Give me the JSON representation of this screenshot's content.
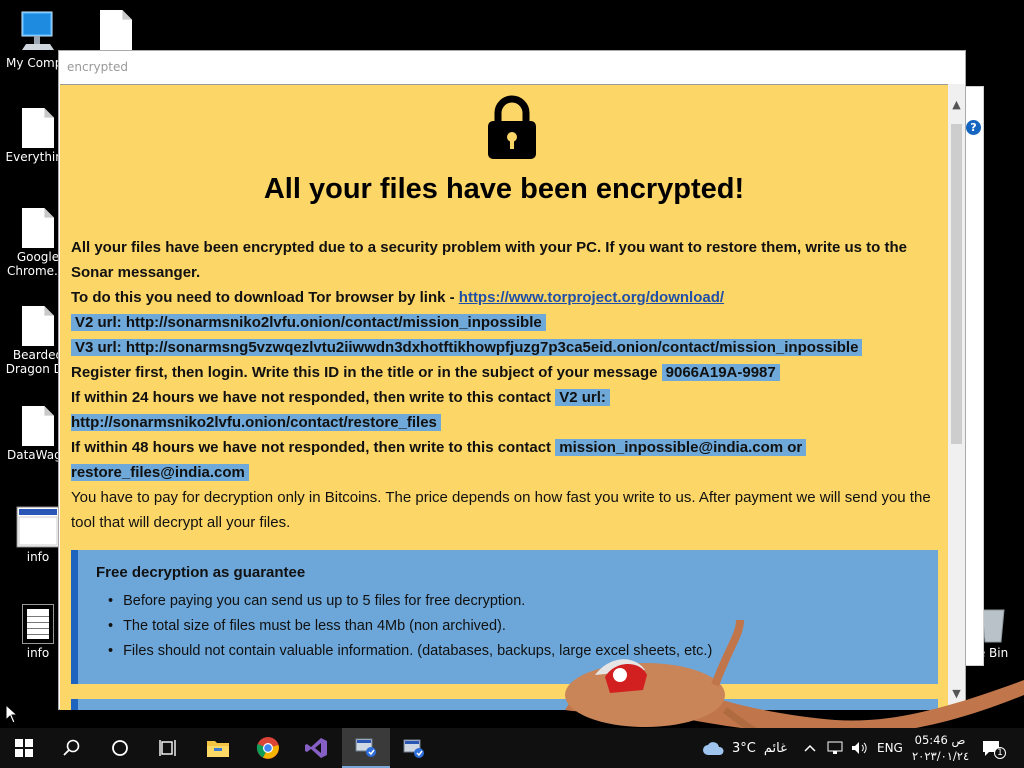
{
  "desktop": {
    "icons": [
      {
        "label": "My Compu",
        "icon": "computer-icon"
      },
      {
        "label": "",
        "icon": "file-icon"
      },
      {
        "label": "Everything",
        "icon": "file-icon"
      },
      {
        "label": "Google\nChrome.In",
        "icon": "file-icon"
      },
      {
        "label": "Bearded\nDragon De",
        "icon": "file-icon"
      },
      {
        "label": "DataWago",
        "icon": "file-icon"
      },
      {
        "label": "info",
        "icon": "window-icon"
      },
      {
        "label": "info",
        "icon": "text-file-icon"
      },
      {
        "label": "e Bin",
        "icon": "recycle-bin-icon"
      }
    ]
  },
  "window": {
    "title": "encrypted"
  },
  "note": {
    "heading": "All your files have been encrypted!",
    "para1": "All your files have been encrypted due to a security problem with your PC. If you want to restore them, write us to the Sonar messanger.",
    "tor_prefix": "To do this you need to download Tor browser by link - ",
    "tor_link": "https://www.torproject.org/download/",
    "v2_url": "V2 url: http://sonarmsniko2lvfu.onion/contact/mission_inpossible",
    "v3_url": "V3 url: http://sonarmsng5vzwqezlvtu2iiwwdn3dxhotftikhowpfjuzg7p3ca5eid.onion/contact/mission_inpossible",
    "register_prefix": "Register first, then login. Write this ID in the title or in the subject of your message",
    "id": "9066A19A-9987",
    "within24_prefix": "If within 24 hours we have not responded, then write to this contact",
    "within24_contact_a": "V2 url:",
    "within24_contact_b": "http://sonarmsniko2lvfu.onion/contact/restore_files",
    "within48_prefix": "If within 48 hours we have not responded, then write to this contact",
    "within48_contact_a": "mission_inpossible@india.com or",
    "within48_contact_b": "restore_files@india.com",
    "pay": "You have to pay for decryption only in Bitcoins. The price depends on how fast you write to us. After payment we will send you the tool that will decrypt all your files.",
    "guarantee": {
      "title": "Free decryption as guarantee",
      "items": [
        "Before paying you can send us up to 5 files for free decryption.",
        "The total size of files must be less than 4Mb (non archived).",
        "Files should not contain valuable information. (databases, backups, large excel sheets, etc.)"
      ]
    }
  },
  "taskbar": {
    "weather_temp": "3°C",
    "weather_text": "غائم",
    "language": "ENG",
    "time": "05:46 ص",
    "date": "٢٠٢٣/٠١/٢٤",
    "notification_count": "1"
  }
}
